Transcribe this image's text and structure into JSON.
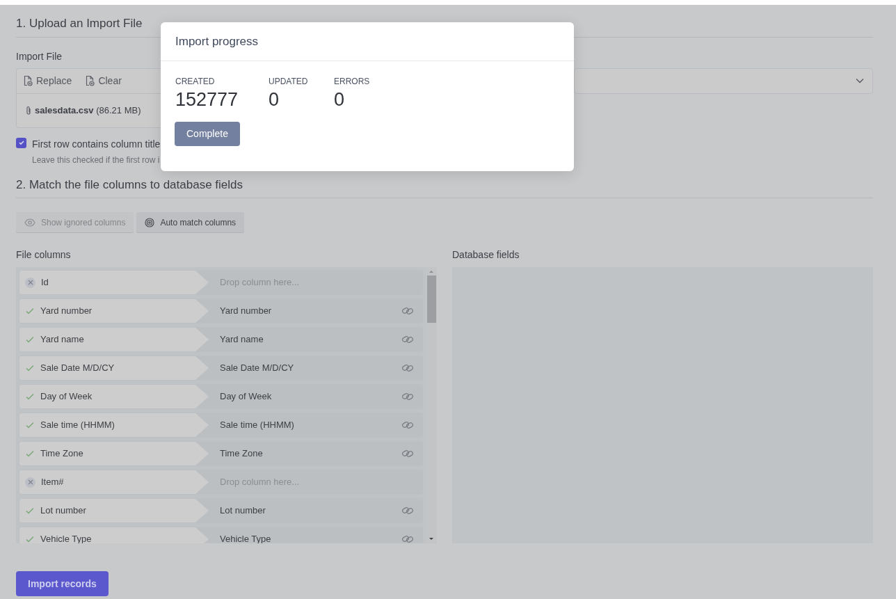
{
  "section_1": {
    "title": "1. Upload an Import File",
    "import_file": {
      "label": "Import File",
      "actions": [
        "Replace",
        "Clear"
      ],
      "file_name": "salesdata.csv",
      "file_size": "(86.21 MB)"
    },
    "first_row_titles": {
      "checked": true,
      "label": "First row contains column title",
      "hint": "Leave this checked if the first row i"
    }
  },
  "section_2": {
    "title": "2. Match the file columns to database fields",
    "buttons": [
      {
        "label": "Show ignored columns",
        "disabled": true,
        "kind": "eye"
      },
      {
        "label": "Auto match columns",
        "disabled": false,
        "kind": "target"
      }
    ],
    "file_columns_label": "File columns",
    "database_fields_label": "Database fields",
    "rows": [
      {
        "name": "Id",
        "mapped": false,
        "placeholder": "Drop column here..."
      },
      {
        "name": "Yard number",
        "mapped": true,
        "field": "Yard number"
      },
      {
        "name": "Yard name",
        "mapped": true,
        "field": "Yard name"
      },
      {
        "name": "Sale Date M/D/CY",
        "mapped": true,
        "field": "Sale Date M/D/CY"
      },
      {
        "name": "Day of Week",
        "mapped": true,
        "field": "Day of Week"
      },
      {
        "name": "Sale time (HHMM)",
        "mapped": true,
        "field": "Sale time (HHMM)"
      },
      {
        "name": "Time Zone",
        "mapped": true,
        "field": "Time Zone"
      },
      {
        "name": "Item#",
        "mapped": false,
        "placeholder": "Drop column here..."
      },
      {
        "name": "Lot number",
        "mapped": true,
        "field": "Lot number"
      },
      {
        "name": "Vehicle Type",
        "mapped": true,
        "field": "Vehicle Type"
      }
    ]
  },
  "import_button": "Import records",
  "modal": {
    "title": "Import progress",
    "stats": [
      {
        "label": "CREATED",
        "value": "152777"
      },
      {
        "label": "UPDATED",
        "value": "0"
      },
      {
        "label": "ERRORS",
        "value": "0"
      }
    ],
    "button": "Complete"
  }
}
